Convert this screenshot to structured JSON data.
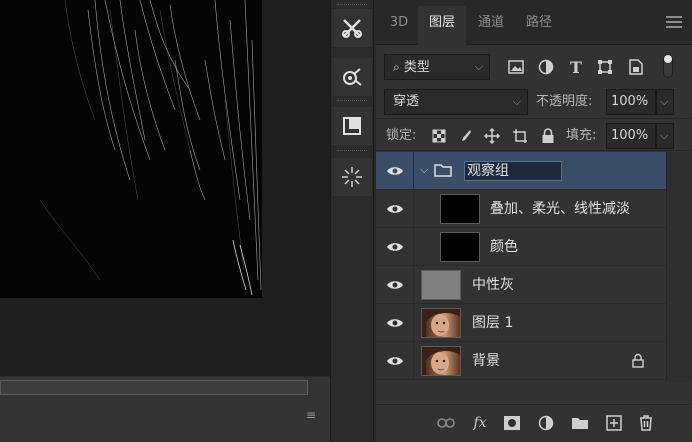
{
  "panel": {
    "tabs": [
      {
        "label": "3D",
        "active": false
      },
      {
        "label": "图层",
        "active": true
      },
      {
        "label": "通道",
        "active": false
      },
      {
        "label": "路径",
        "active": false
      }
    ],
    "filter": {
      "kind_value": "类型"
    },
    "blend": {
      "mode_value": "穿透",
      "opacity_label": "不透明度:",
      "opacity_value": "100%"
    },
    "lock": {
      "label": "锁定:",
      "fill_label": "填充:",
      "fill_value": "100%"
    }
  },
  "layers": [
    {
      "name": "观察组",
      "type": "group",
      "selected": true,
      "visible": true,
      "editing": true
    },
    {
      "name": "叠加、柔光、线性减淡",
      "type": "layer",
      "thumb_color": "#000000",
      "visible": true,
      "indented": true
    },
    {
      "name": "颜色",
      "type": "layer",
      "thumb_color": "#000000",
      "visible": true,
      "indented": true
    },
    {
      "name": "中性灰",
      "type": "layer",
      "thumb_color": "#808080",
      "visible": true
    },
    {
      "name": "图层 1",
      "type": "layer",
      "thumb": "portrait",
      "visible": true
    },
    {
      "name": "背景",
      "type": "layer",
      "thumb": "portrait",
      "visible": true,
      "locked": true
    }
  ],
  "colors": {
    "accent_selected": "#3b4e68",
    "panel_bg": "#323232",
    "canvas_bg": "#060606"
  },
  "icons": {
    "dock": [
      "tools-brush-scissors-icon",
      "channel-mixer-icon",
      "navigator-icon",
      "starburst-icon"
    ],
    "filter": [
      "image-filter-icon",
      "adjustment-filter-icon",
      "type-filter-icon",
      "shape-filter-icon",
      "smart-object-filter-icon"
    ],
    "lock": [
      "lock-transparent-icon",
      "lock-pixels-icon",
      "lock-position-icon",
      "lock-artboard-icon",
      "lock-all-icon"
    ],
    "footer": [
      "link-layers-icon",
      "fx-icon",
      "add-mask-icon",
      "adjustment-layer-icon",
      "new-group-icon",
      "new-layer-icon",
      "delete-layer-icon"
    ]
  },
  "footer": {
    "fx_label": "fx"
  }
}
